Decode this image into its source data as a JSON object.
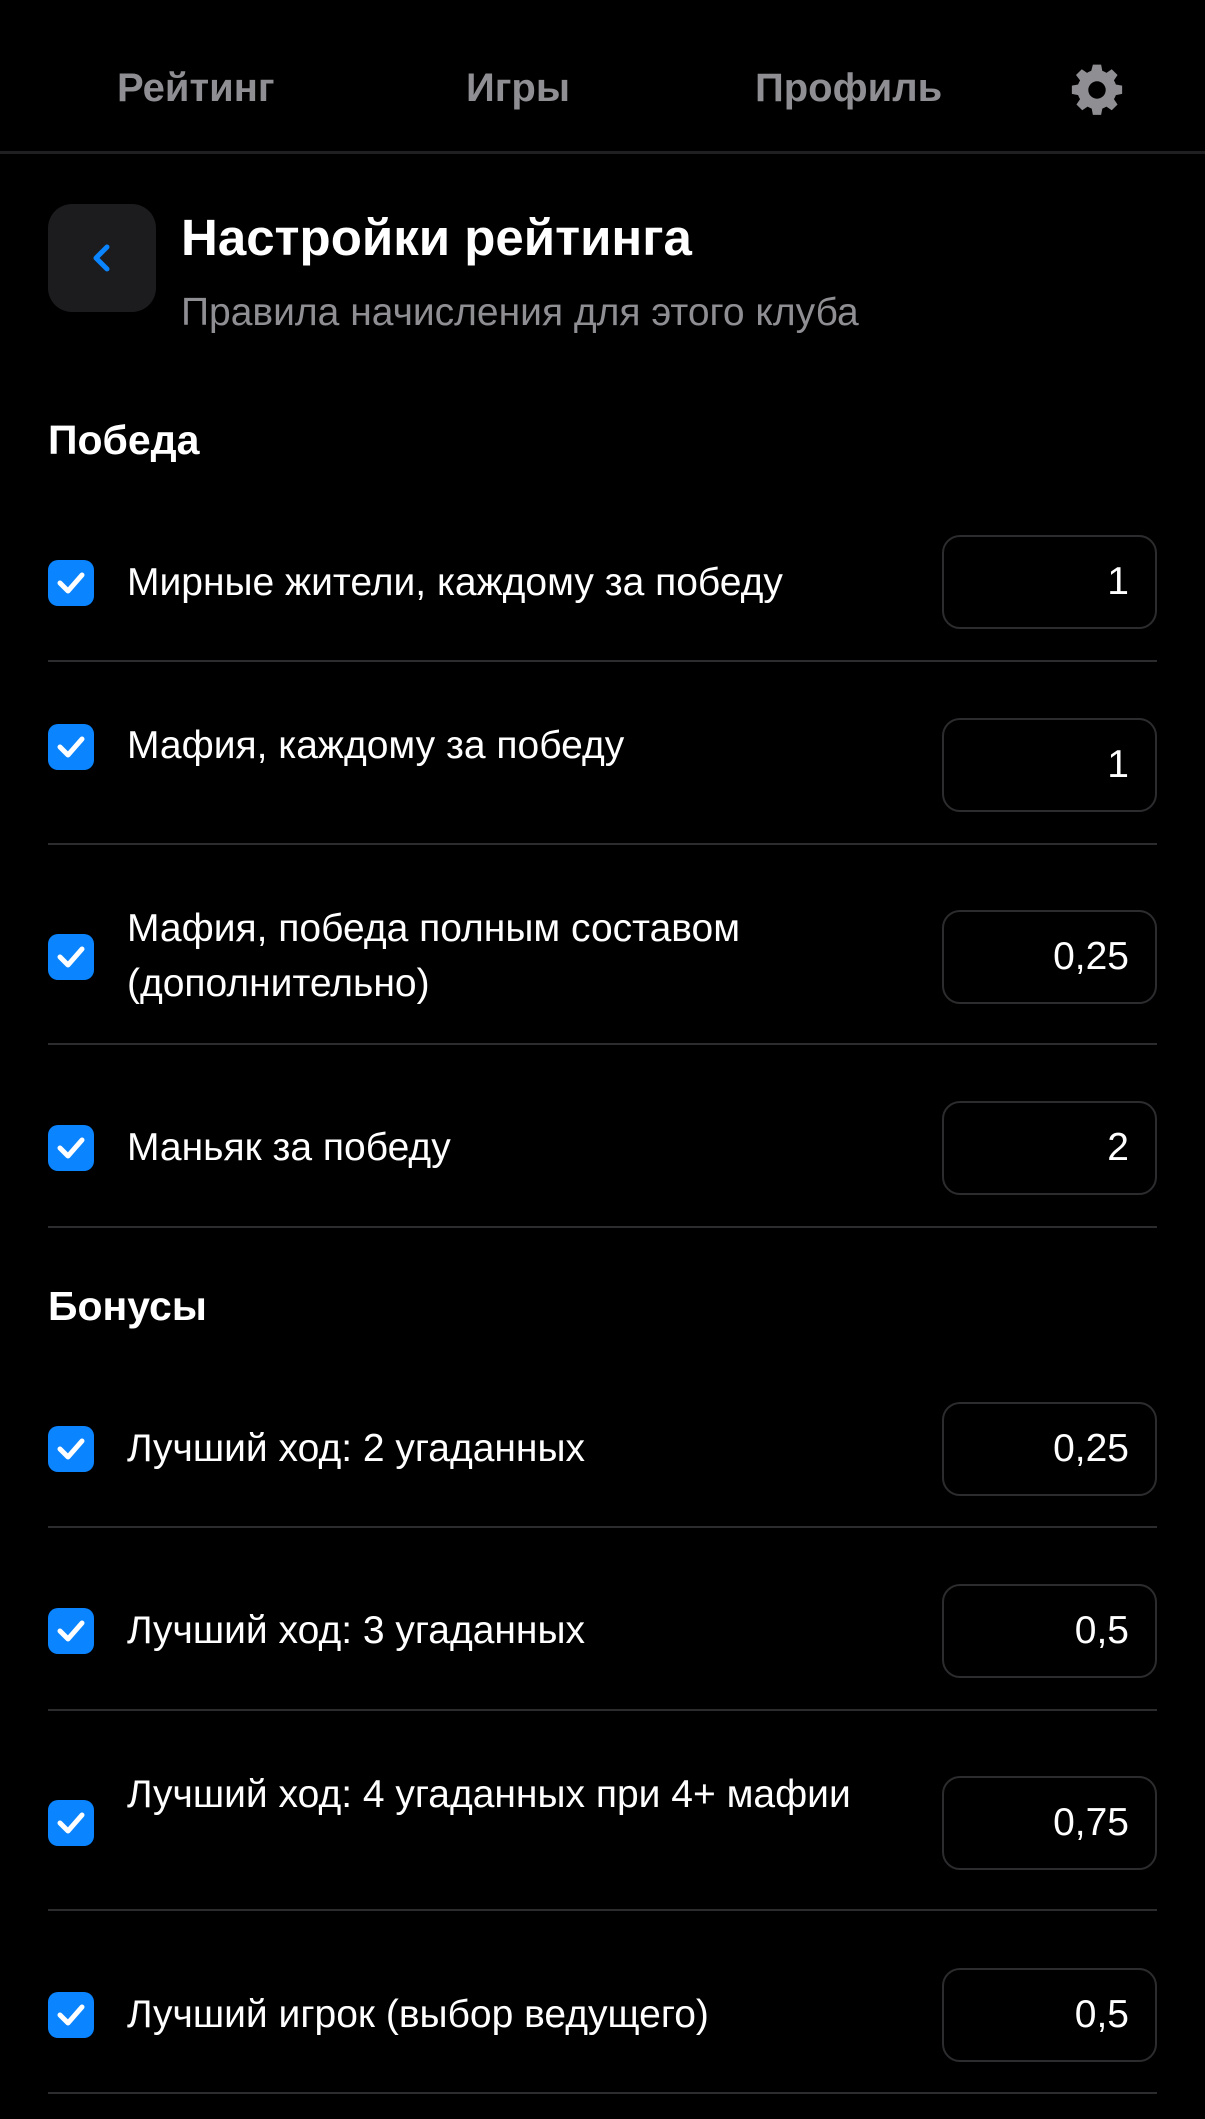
{
  "nav": {
    "tabs": [
      {
        "label": "Рейтинг"
      },
      {
        "label": "Игры"
      },
      {
        "label": "Профиль"
      }
    ],
    "settings_icon": "gear-icon"
  },
  "header": {
    "back_icon": "chevron-left-icon",
    "title": "Настройки рейтинга",
    "subtitle": "Правила начисления для этого клуба"
  },
  "colors": {
    "accent": "#0a84ff",
    "background": "#000000",
    "secondary_text": "#8e8e93",
    "card": "#1c1c1e",
    "separator": "#2c2c2e"
  },
  "sections": [
    {
      "title": "Победа",
      "rows": [
        {
          "label": "Мирные жители, каждому за победу",
          "value": "1",
          "checked": true
        },
        {
          "label": "Мафия, каждому за победу",
          "value": "1",
          "checked": true
        },
        {
          "label": "Мафия, победа полным составом (дополнительно)",
          "value": "0,25",
          "checked": true
        },
        {
          "label": "Маньяк за победу",
          "value": "2",
          "checked": true
        }
      ]
    },
    {
      "title": "Бонусы",
      "rows": [
        {
          "label": "Лучший ход: 2 угаданных",
          "value": "0,25",
          "checked": true
        },
        {
          "label": "Лучший ход: 3 угаданных",
          "value": "0,5",
          "checked": true
        },
        {
          "label": "Лучший ход: 4 угаданных при 4+ мафии",
          "value": "0,75",
          "checked": true
        },
        {
          "label": "Лучший игрок (выбор ведущего)",
          "value": "0,5",
          "checked": true
        }
      ]
    }
  ]
}
